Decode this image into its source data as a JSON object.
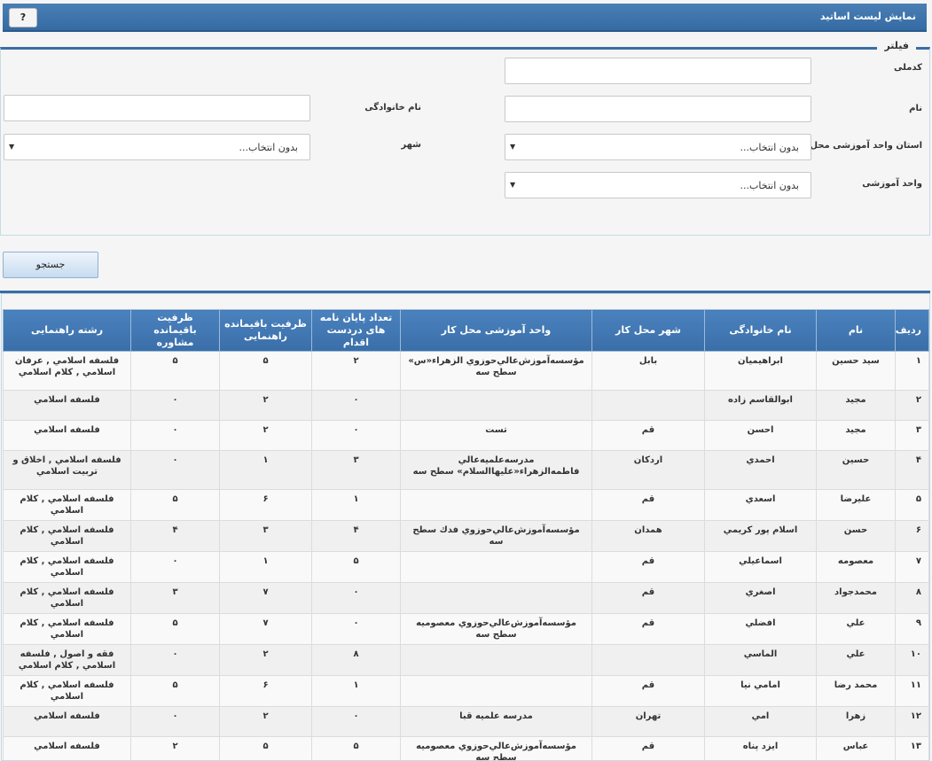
{
  "header": {
    "title": "نمایش لیست اساتید",
    "help_label": "?"
  },
  "filter": {
    "legend": "فیلتر",
    "national_code_label": "کدملی",
    "first_name_label": "نام",
    "last_name_label": "نام خانوادگی",
    "province_label": "استان واحد آموزشی محل کار:",
    "city_label": "شهر",
    "unit_label": "واحد آموزشی",
    "province_value": "بدون انتخاب...",
    "city_value": "بدون انتخاب...",
    "unit_value": "بدون انتخاب..."
  },
  "search_label": "جستجو",
  "table": {
    "headers": [
      "ردیف",
      "نام",
      "نام خانوادگی",
      "شهر محل کار",
      "واحد آموزشی محل کار",
      "تعداد پایان نامه های دردست اقدام",
      "ظرفیت باقیمانده راهنمایی",
      "ظرفیت باقیمانده مشاوره",
      "رشته راهنمایی"
    ],
    "rows": [
      [
        "۱",
        "سید حسین",
        "ابراهیمیان",
        "بابل",
        "مؤسسه‌آموزش‌عالي‌حوزوي الزهراء«س» سطح سه",
        "۲",
        "۵",
        "۵",
        "فلسفه اسلامي , عرفان اسلامي , کلام اسلامي"
      ],
      [
        "۲",
        "مجيد",
        "ابوالقاسم زاده",
        "",
        "",
        "۰",
        "۲",
        "۰",
        "فلسفه اسلامي"
      ],
      [
        "۳",
        "مجيد",
        "احسن",
        "قم",
        "تست",
        "۰",
        "۲",
        "۰",
        "فلسفه اسلامي"
      ],
      [
        "۴",
        "حسين",
        "احمدي",
        "اردکان",
        "مدرسه‌علميه‌عالي فاطمه‌الزهراء«عليهاالسلام» سطح سه",
        "۳",
        "۱",
        "۰",
        "فلسفه اسلامي , اخلاق و تربيت اسلامي"
      ],
      [
        "۵",
        "عليرضا",
        "اسعدي",
        "قم",
        "",
        "۱",
        "۶",
        "۵",
        "فلسفه اسلامي , کلام اسلامي"
      ],
      [
        "۶",
        "حسن",
        "اسلام پور کريمي",
        "همدان",
        "مؤسسه‌آموزش‌عالي‌حوزوي فدك سطح سه",
        "۴",
        "۳",
        "۴",
        "فلسفه اسلامي , کلام اسلامي"
      ],
      [
        "۷",
        "معصومه",
        "اسماعيلي",
        "قم",
        "",
        "۵",
        "۱",
        "۰",
        "فلسفه اسلامي , کلام اسلامي"
      ],
      [
        "۸",
        "محمدجواد",
        "اصغري",
        "قم",
        "",
        "۰",
        "۷",
        "۳",
        "فلسفه اسلامي , کلام اسلامي"
      ],
      [
        "۹",
        "علي",
        "افضلي",
        "قم",
        "مؤسسه‌آموزش‌عالي‌حوزوي معصوميه سطح سه",
        "۰",
        "۷",
        "۵",
        "فلسفه اسلامي , کلام اسلامي"
      ],
      [
        "۱۰",
        "علي",
        "الماسي",
        "",
        "",
        "۸",
        "۲",
        "۰",
        "فقه و اصول , فلسفه اسلامي , کلام اسلامي"
      ],
      [
        "۱۱",
        "محمد رضا",
        "امامي نيا",
        "قم",
        "",
        "۱",
        "۶",
        "۵",
        "فلسفه اسلامي , کلام اسلامي"
      ],
      [
        "۱۲",
        "زهرا",
        "امي",
        "تهران",
        "مدرسه علميه قبا",
        "۰",
        "۲",
        "۰",
        "فلسفه اسلامي"
      ],
      [
        "۱۳",
        "عباس",
        "ايزد پناه",
        "قم",
        "مؤسسه‌آموزش‌عالي‌حوزوي معصوميه سطح سه",
        "۵",
        "۵",
        "۲",
        "فلسفه اسلامي"
      ]
    ]
  }
}
